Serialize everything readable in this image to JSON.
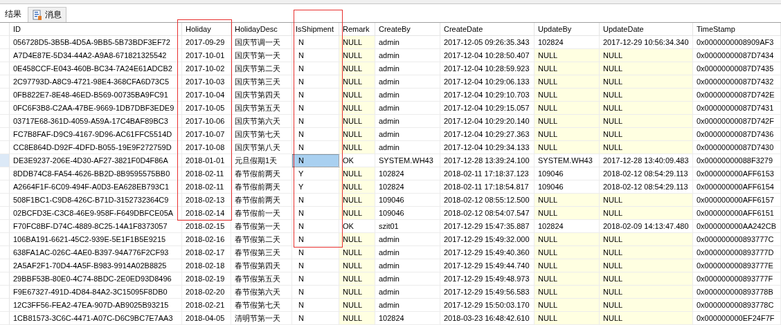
{
  "tabs": [
    {
      "label": "结果",
      "selected": true,
      "kind": "grid"
    },
    {
      "label": "消息",
      "selected": false,
      "kind": "messages"
    }
  ],
  "table": {
    "columns": [
      {
        "label": "ID"
      },
      {
        "label": "Holiday"
      },
      {
        "label": "HolidayDesc"
      },
      {
        "label": "IsShipment"
      },
      {
        "label": "Remark"
      },
      {
        "label": "CreateBy"
      },
      {
        "label": "CreateDate"
      },
      {
        "label": "UpdateBy"
      },
      {
        "label": "UpdateDate"
      },
      {
        "label": "TimeStamp"
      }
    ],
    "rows": [
      {
        "selected": false,
        "cells": [
          "056728D5-3B5B-4D5A-9BB5-5B73BDF3EF72",
          "2017-09-29",
          "国庆节调一天",
          "N",
          {
            "text": "NULL",
            "null": true
          },
          "admin",
          "2017-12-05 09:26:35.343",
          "102824",
          "2017-12-29 10:56:34.340",
          "0x0000000008909AF3"
        ]
      },
      {
        "selected": false,
        "cells": [
          "A7D4E87E-5D34-44A2-A9A8-671821325542",
          "2017-10-01",
          "国庆节第一天",
          "N",
          {
            "text": "NULL",
            "null": true
          },
          "admin",
          "2017-12-04 10:28:50.407",
          {
            "text": "NULL",
            "null": true
          },
          {
            "text": "NULL",
            "null": true
          },
          "0x00000000087D7434"
        ]
      },
      {
        "selected": false,
        "cells": [
          "0E458CCF-E043-460B-BC34-7A24E61ADCB2",
          "2017-10-02",
          "国庆节第二天",
          "N",
          {
            "text": "NULL",
            "null": true
          },
          "admin",
          "2017-12-04 10:28:59.923",
          {
            "text": "NULL",
            "null": true
          },
          {
            "text": "NULL",
            "null": true
          },
          "0x00000000087D7435"
        ]
      },
      {
        "selected": false,
        "cells": [
          "2C97793D-A8C9-4721-98E4-368CFA6D73C5",
          "2017-10-03",
          "国庆节第三天",
          "N",
          {
            "text": "NULL",
            "null": true
          },
          "admin",
          "2017-12-04 10:29:06.133",
          {
            "text": "NULL",
            "null": true
          },
          {
            "text": "NULL",
            "null": true
          },
          "0x00000000087D7432"
        ]
      },
      {
        "selected": false,
        "cells": [
          "0FB822E7-8E48-46ED-B569-00735BA9FC91",
          "2017-10-04",
          "国庆节第四天",
          "N",
          {
            "text": "NULL",
            "null": true
          },
          "admin",
          "2017-12-04 10:29:10.703",
          {
            "text": "NULL",
            "null": true
          },
          {
            "text": "NULL",
            "null": true
          },
          "0x00000000087D742E"
        ]
      },
      {
        "selected": false,
        "cells": [
          "0FC6F3B8-C2AA-47BE-9669-1DB7DBF3EDE9",
          "2017-10-05",
          "国庆节第五天",
          "N",
          {
            "text": "NULL",
            "null": true
          },
          "admin",
          "2017-12-04 10:29:15.057",
          {
            "text": "NULL",
            "null": true
          },
          {
            "text": "NULL",
            "null": true
          },
          "0x00000000087D7431"
        ]
      },
      {
        "selected": false,
        "cells": [
          "03717E68-361D-4059-A59A-17C4BAF89BC3",
          "2017-10-06",
          "国庆节第六天",
          "N",
          {
            "text": "NULL",
            "null": true
          },
          "admin",
          "2017-12-04 10:29:20.140",
          {
            "text": "NULL",
            "null": true
          },
          {
            "text": "NULL",
            "null": true
          },
          "0x00000000087D742F"
        ]
      },
      {
        "selected": false,
        "cells": [
          "FC7B8FAF-D9C9-4167-9D96-AC61FFC5514D",
          "2017-10-07",
          "国庆节第七天",
          "N",
          {
            "text": "NULL",
            "null": true
          },
          "admin",
          "2017-12-04 10:29:27.363",
          {
            "text": "NULL",
            "null": true
          },
          {
            "text": "NULL",
            "null": true
          },
          "0x00000000087D7436"
        ]
      },
      {
        "selected": false,
        "cells": [
          "CC8E864D-D92F-4DFD-B055-19E9F272759D",
          "2017-10-08",
          "国庆节第八天",
          "N",
          {
            "text": "NULL",
            "null": true
          },
          "admin",
          "2017-12-04 10:29:34.133",
          {
            "text": "NULL",
            "null": true
          },
          {
            "text": "NULL",
            "null": true
          },
          "0x00000000087D7430"
        ]
      },
      {
        "selected": true,
        "cells": [
          "DE3E9237-206E-4D30-AF27-3821F0D4F86A",
          "2018-01-01",
          "元旦假期1天",
          "N",
          "OK",
          "SYSTEM.WH43",
          "2017-12-28 13:39:24.100",
          "SYSTEM.WH43",
          "2017-12-28 13:40:09.483",
          "0x00000000088F3279"
        ]
      },
      {
        "selected": false,
        "cells": [
          "8DDB74C8-FA54-4626-BB2D-8B9595575BB0",
          "2018-02-11",
          "春节假前两天",
          "Y",
          {
            "text": "NULL",
            "null": true
          },
          "102824",
          "2018-02-11 17:18:37.123",
          "109046",
          "2018-02-12 08:54:29.113",
          "0x000000000AFF6153"
        ]
      },
      {
        "selected": false,
        "cells": [
          "A2664F1F-6C09-494F-A0D3-EA628EB793C1",
          "2018-02-11",
          "春节假前两天",
          "Y",
          {
            "text": "NULL",
            "null": true
          },
          "102824",
          "2018-02-11 17:18:54.817",
          "109046",
          "2018-02-12 08:54:29.113",
          "0x000000000AFF6154"
        ]
      },
      {
        "selected": false,
        "cells": [
          "508F1BC1-C9D8-426C-B71D-3152732364C9",
          "2018-02-13",
          "春节假前两天",
          "N",
          {
            "text": "NULL",
            "null": true
          },
          "109046",
          "2018-02-12 08:55:12.500",
          {
            "text": "NULL",
            "null": true
          },
          {
            "text": "NULL",
            "null": true
          },
          "0x000000000AFF6157"
        ]
      },
      {
        "selected": false,
        "cells": [
          "02BCFD3E-C3C8-46E9-958F-F649DBFCE05A",
          "2018-02-14",
          "春节假前一天",
          "N",
          {
            "text": "NULL",
            "null": true
          },
          "109046",
          "2018-02-12 08:54:07.547",
          {
            "text": "NULL",
            "null": true
          },
          {
            "text": "NULL",
            "null": true
          },
          "0x000000000AFF6151"
        ]
      },
      {
        "selected": false,
        "cells": [
          "F70FC8BF-D74C-4889-8C25-14A1F8373057",
          "2018-02-15",
          "春节假第一天",
          "N",
          "OK",
          "szit01",
          "2017-12-29 15:47:35.887",
          "102824",
          "2018-02-09 14:13:47.480",
          "0x000000000AA242CB"
        ]
      },
      {
        "selected": false,
        "cells": [
          "106BA191-6621-45C2-939E-5E1F1B5E9215",
          "2018-02-16",
          "春节假第二天",
          "N",
          {
            "text": "NULL",
            "null": true
          },
          "admin",
          "2017-12-29 15:49:32.000",
          {
            "text": "NULL",
            "null": true
          },
          {
            "text": "NULL",
            "null": true
          },
          "0x000000000893777C"
        ]
      },
      {
        "selected": false,
        "cells": [
          "638FA1AC-026C-4AE0-B397-94A776F2CF93",
          "2018-02-17",
          "春节假第三天",
          "N",
          {
            "text": "NULL",
            "null": true
          },
          "admin",
          "2017-12-29 15:49:40.360",
          {
            "text": "NULL",
            "null": true
          },
          {
            "text": "NULL",
            "null": true
          },
          "0x000000000893777D"
        ]
      },
      {
        "selected": false,
        "cells": [
          "2A5AF2F1-70D4-4A5F-B983-9914A02B8825",
          "2018-02-18",
          "春节假第四天",
          "N",
          {
            "text": "NULL",
            "null": true
          },
          "admin",
          "2017-12-29 15:49:44.740",
          {
            "text": "NULL",
            "null": true
          },
          {
            "text": "NULL",
            "null": true
          },
          "0x000000000893777E"
        ]
      },
      {
        "selected": false,
        "cells": [
          "29BBF53B-80E0-4C74-8BDC-2E0ED93D8496",
          "2018-02-19",
          "春节假第五天",
          "N",
          {
            "text": "NULL",
            "null": true
          },
          "admin",
          "2017-12-29 15:49:48.973",
          {
            "text": "NULL",
            "null": true
          },
          {
            "text": "NULL",
            "null": true
          },
          "0x000000000893777F"
        ]
      },
      {
        "selected": false,
        "cells": [
          "F9E67327-491D-4D84-84A2-3C15095F8DB0",
          "2018-02-20",
          "春节假第六天",
          "N",
          {
            "text": "NULL",
            "null": true
          },
          "admin",
          "2017-12-29 15:49:56.583",
          {
            "text": "NULL",
            "null": true
          },
          {
            "text": "NULL",
            "null": true
          },
          "0x000000000893778B"
        ]
      },
      {
        "selected": false,
        "cells": [
          "12C3FF56-FEA2-47EA-907D-AB9025B93215",
          "2018-02-21",
          "春节假第七天",
          "N",
          {
            "text": "NULL",
            "null": true
          },
          "admin",
          "2017-12-29 15:50:03.170",
          {
            "text": "NULL",
            "null": true
          },
          {
            "text": "NULL",
            "null": true
          },
          "0x000000000893778C"
        ]
      },
      {
        "selected": false,
        "cells": [
          "1CB81573-3C6C-4471-A07C-D6C9BC7E7AA3",
          "2018-04-05",
          "清明节第一天",
          "N",
          {
            "text": "NULL",
            "null": true
          },
          "102824",
          "2018-03-23 16:48:42.610",
          {
            "text": "NULL",
            "null": true
          },
          {
            "text": "NULL",
            "null": true
          },
          "0x000000000EF24F7F"
        ]
      }
    ]
  }
}
